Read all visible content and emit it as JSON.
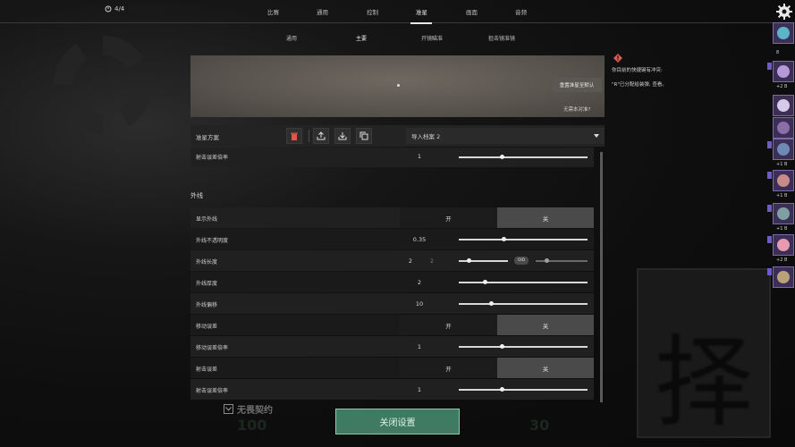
{
  "topbar": {
    "counter": "4/4",
    "tabs": [
      "比赛",
      "通用",
      "控制",
      "准星",
      "画面",
      "音频"
    ],
    "active_tab": "准星"
  },
  "subtabs": {
    "items": [
      "通用",
      "主要",
      "开镜瞄准",
      "狙击镜准镜"
    ],
    "active": "主要"
  },
  "preview": {
    "reset_label": "重置准星至默认",
    "no_show_label": "无需本对准?"
  },
  "toolbar": {
    "profile_label": "准星方案",
    "import_label": "导入档案 2",
    "icons": [
      "trash-icon",
      "upload-icon",
      "download-icon",
      "copy-icon"
    ]
  },
  "settings": {
    "top_row": {
      "label": "射击误差倍率",
      "value": "1"
    },
    "section_title": "外线",
    "rows": [
      {
        "label": "显示外线",
        "type": "toggle",
        "on": "开",
        "off": "关",
        "selected": "off"
      },
      {
        "label": "外线不透明度",
        "type": "slider",
        "value": "0.35",
        "level": 0.35
      },
      {
        "label": "外线长度",
        "type": "dual-slider",
        "value_a": "2",
        "value_b": "2",
        "link_label": "OID"
      },
      {
        "label": "外线厚度",
        "type": "slider",
        "value": "2",
        "level": 0.2
      },
      {
        "label": "外线偏移",
        "type": "slider",
        "value": "10",
        "level": 0.25
      },
      {
        "label": "移动误差",
        "type": "toggle",
        "on": "开",
        "off": "关",
        "selected": "off"
      },
      {
        "label": "移动误差倍率",
        "type": "slider",
        "value": "1",
        "level": 0.33
      },
      {
        "label": "射击误差",
        "type": "toggle",
        "on": "开",
        "off": "关",
        "selected": "off"
      },
      {
        "label": "射击误差倍率",
        "type": "slider",
        "value": "1",
        "level": 0.33
      }
    ]
  },
  "notice": {
    "line1": "你目前的快捷键有冲突:",
    "line2": "\"R\"已分配给装弹, 查看。"
  },
  "avatars": {
    "top_count": "8",
    "labels": [
      "+2 B",
      "+1 B",
      "+1 B",
      "+1 B",
      "+2 B"
    ]
  },
  "bottom": {
    "checkbox_label": "无畏契约",
    "close_button": "关闭设置",
    "bg_left": "100",
    "bg_right": "30"
  },
  "colors": {
    "accent_green": "#3f7a63",
    "avatar_purple": "#6d5cc4",
    "warn_red": "#e0584a"
  }
}
